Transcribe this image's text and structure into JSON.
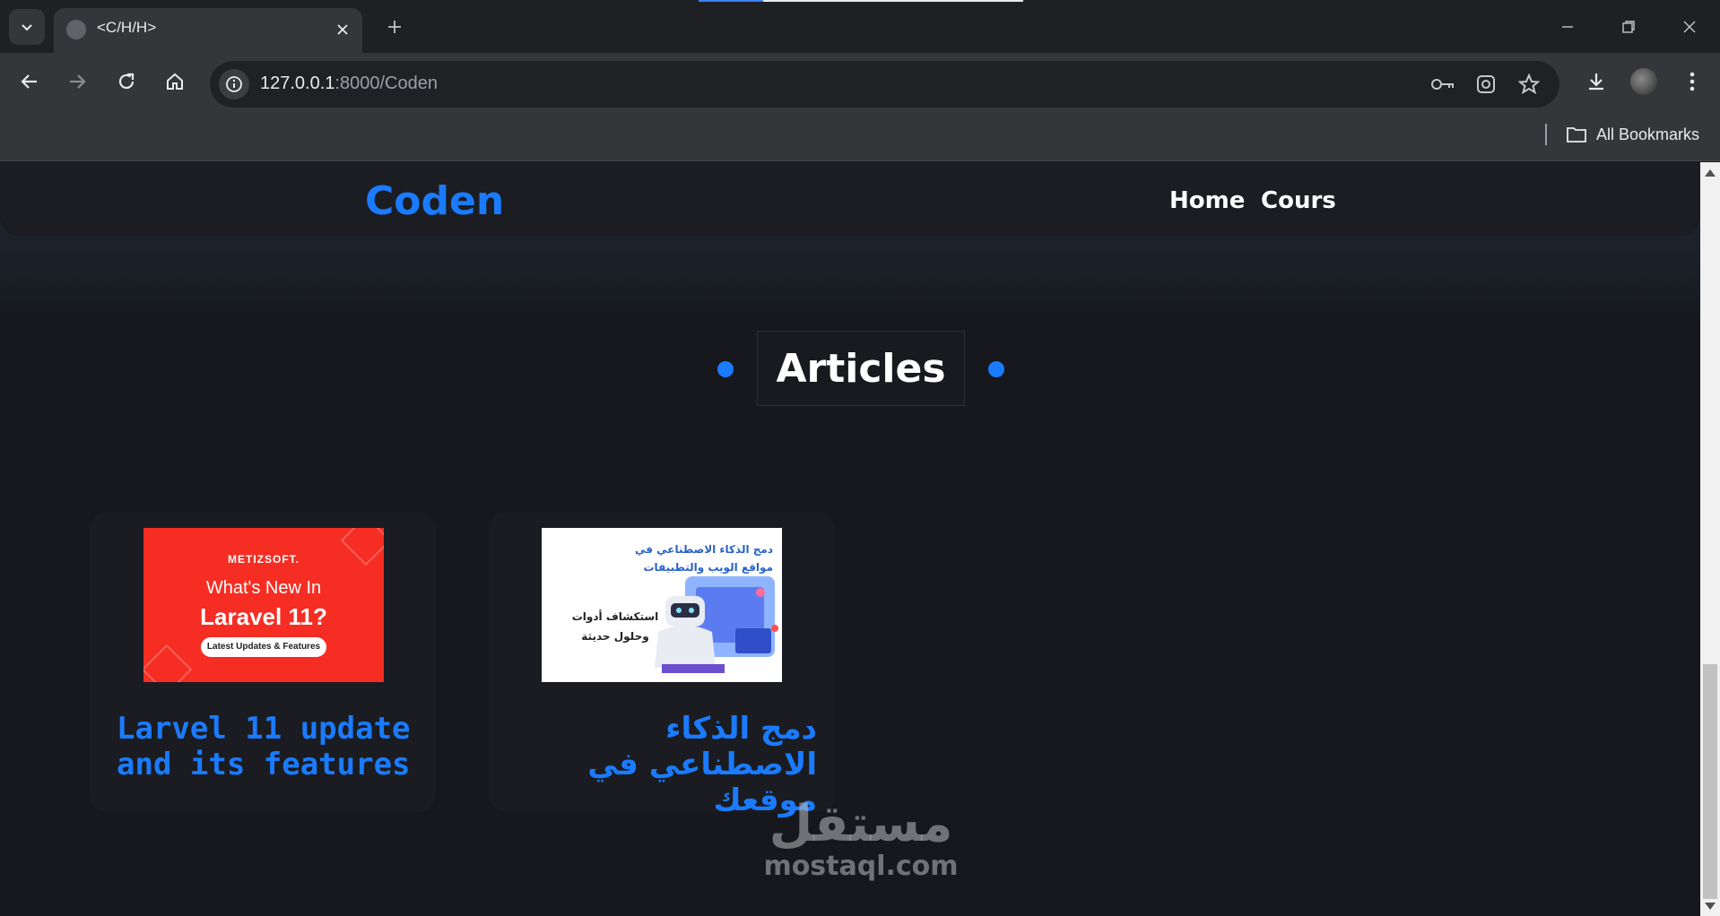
{
  "browser": {
    "tab_title": "<C/H/H>",
    "url_host": "127.0.0.1",
    "url_rest": ":8000/Coden",
    "bookmarks_label": "All Bookmarks"
  },
  "site": {
    "logo": "Coden",
    "nav": [
      {
        "label": "Home"
      },
      {
        "label": "Cours"
      }
    ],
    "section_title": "Articles",
    "accent_color": "#1a7bff"
  },
  "articles": [
    {
      "title": "Larvel 11 update and its features",
      "image": {
        "brand": "METIZSOFT.",
        "line1": "What's New In",
        "line2": "Laravel 11?",
        "pill": "Latest Updates & Features"
      }
    },
    {
      "title": "دمج الذكاء الاصطناعي في موقعك",
      "image": {
        "headline": "دمج الذكاء الاصطناعي في مواقع الويب والتطبيقات",
        "subline": "استكشاف أدوات وحلول حديثة"
      }
    }
  ],
  "watermark": {
    "arabic": "مستقل",
    "latin": "mostaql.com"
  }
}
